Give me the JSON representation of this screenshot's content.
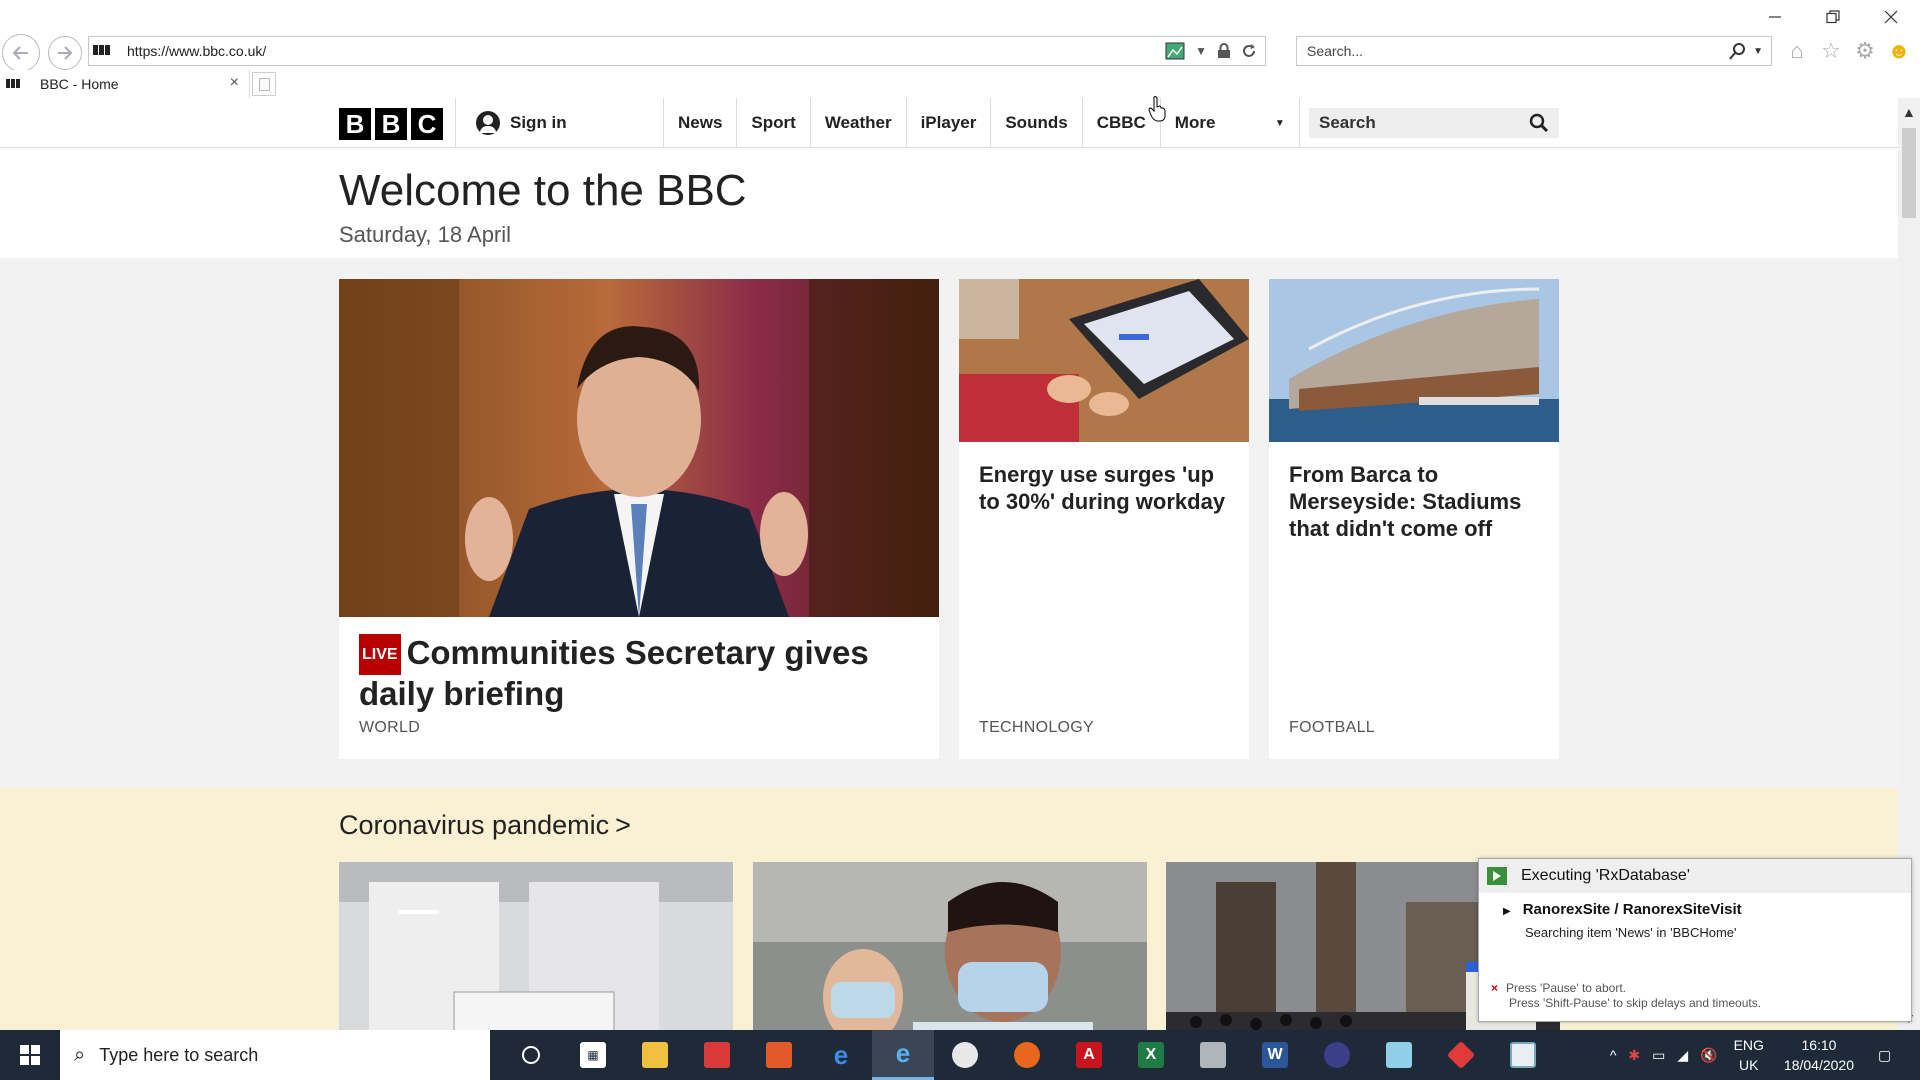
{
  "browser": {
    "url": "https://www.bbc.co.uk/",
    "search_placeholder": "Search...",
    "tab_title": "BBC - Home"
  },
  "bbc_nav": {
    "logo_letters": [
      "B",
      "B",
      "C"
    ],
    "signin_label": "Sign in",
    "links": [
      "News",
      "Sport",
      "Weather",
      "iPlayer",
      "Sounds",
      "CBBC"
    ],
    "more_label": "More",
    "search_placeholder": "Search"
  },
  "hero": {
    "welcome": "Welcome to the BBC",
    "date": "Saturday, 18 April"
  },
  "cards": {
    "lead": {
      "live_badge": "LIVE",
      "title": "Communities Secretary gives daily briefing",
      "tag": "WORLD"
    },
    "c2": {
      "title": "Energy use surges 'up to 30%' during workday",
      "tag": "TECHNOLOGY"
    },
    "c3": {
      "title": "From Barca to Merseyside: Stadiums that didn't come off",
      "tag": "FOOTBALL"
    }
  },
  "section": {
    "title": "Coronavirus pandemic",
    "chevron": ">"
  },
  "ranorex": {
    "header": "Executing 'RxDatabase'",
    "item": "RanorexSite / RanorexSiteVisit",
    "status": "Searching item 'News' in 'BBCHome'",
    "footer_line1": "Press 'Pause' to abort.",
    "footer_line2": "Press 'Shift-Pause' to skip delays and timeouts."
  },
  "taskbar": {
    "search_placeholder": "Type here to search",
    "lang_line1": "ENG",
    "lang_line2": "UK",
    "time": "16:10",
    "date": "18/04/2020"
  },
  "colors": {
    "bbc_live": "#b80000",
    "grey_band": "#f2f2f2",
    "yellow_band": "#faf1d5",
    "taskbar": "#1f2a38"
  }
}
